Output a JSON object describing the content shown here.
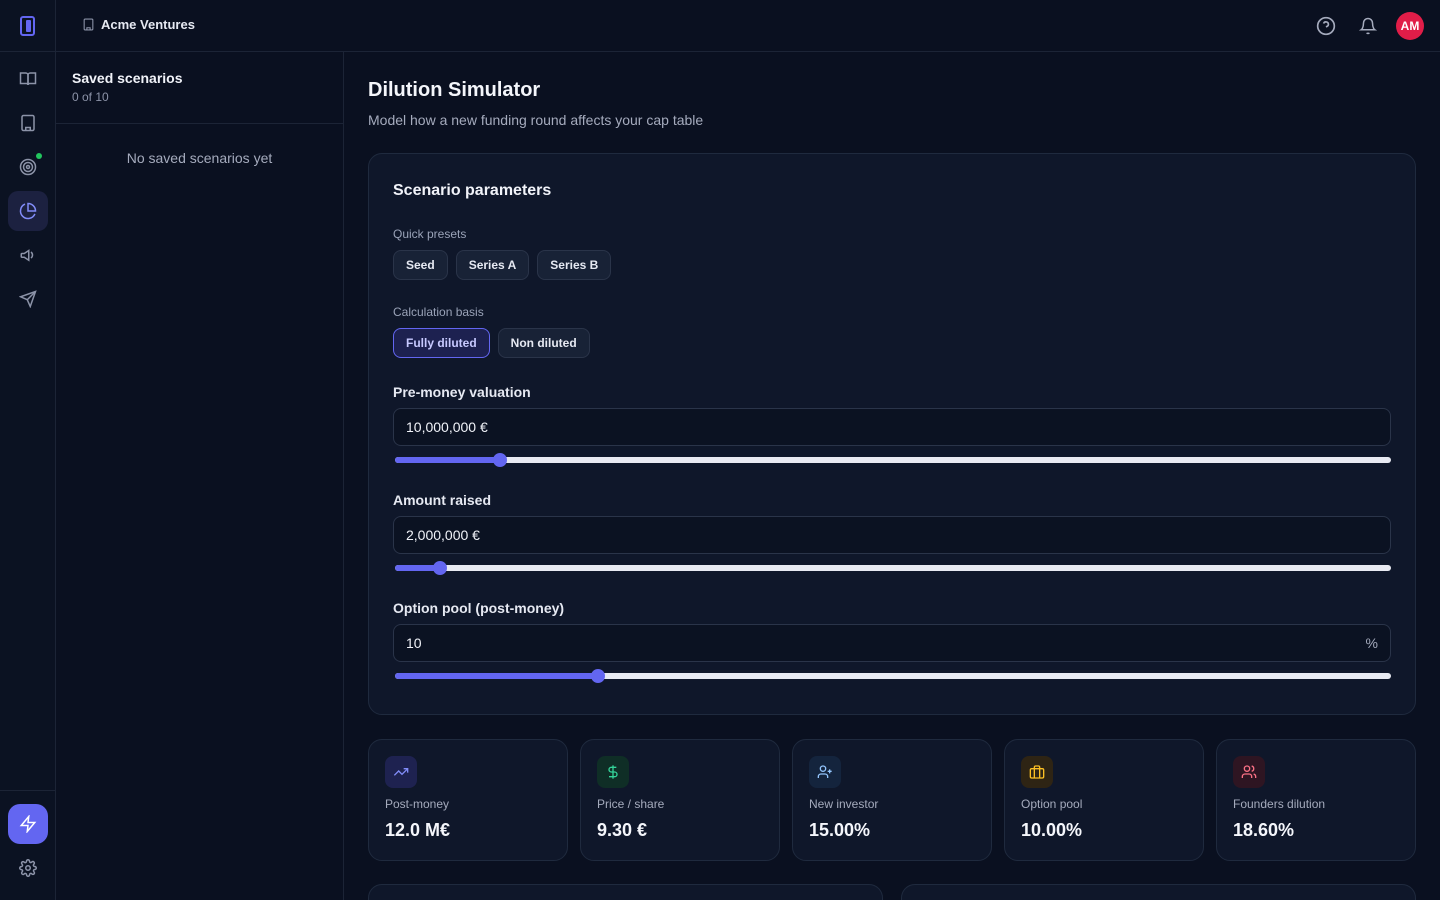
{
  "header": {
    "org_name": "Acme Ventures",
    "avatar_initials": "AM"
  },
  "colors": {
    "accent": "#6366f1",
    "avatar": "#e11d48",
    "status_dot": "#22c55e"
  },
  "rail": {
    "items": [
      "book-icon",
      "building-icon",
      "target-icon",
      "pie-chart-icon",
      "megaphone-icon",
      "send-icon"
    ],
    "active": "pie-chart-icon",
    "bottom": [
      "bolt-icon",
      "gear-icon"
    ]
  },
  "saved": {
    "title": "Saved scenarios",
    "count": "0 of 10",
    "empty": "No saved scenarios yet"
  },
  "main": {
    "title": "Dilution Simulator",
    "subtitle": "Model how a new funding round affects your cap table"
  },
  "params": {
    "title": "Scenario parameters",
    "presets_label": "Quick presets",
    "presets": [
      "Seed",
      "Series A",
      "Series B"
    ],
    "basis_label": "Calculation basis",
    "basis_options": [
      "Fully diluted",
      "Non diluted"
    ],
    "basis_selected": "Fully diluted",
    "premoney": {
      "label": "Pre-money valuation",
      "value": "10,000,000 €",
      "slider": 0.105
    },
    "raised": {
      "label": "Amount raised",
      "value": "2,000,000 €",
      "slider": 0.045
    },
    "pool": {
      "label": "Option pool (post-money)",
      "value": "10",
      "suffix": "%",
      "slider": 0.204
    }
  },
  "stats": [
    {
      "label": "Post-money",
      "value": "12.0 M€",
      "icon": "trending-up-icon",
      "color": "#818cf8",
      "bg": "#1e2250"
    },
    {
      "label": "Price / share",
      "value": "9.30 €",
      "icon": "dollar-icon",
      "color": "#34d399",
      "bg": "#0f2e26"
    },
    {
      "label": "New investor",
      "value": "15.00%",
      "icon": "user-plus-icon",
      "color": "#93c5fd",
      "bg": "#14243d"
    },
    {
      "label": "Option pool",
      "value": "10.00%",
      "icon": "briefcase-icon",
      "color": "#fbbf24",
      "bg": "#2e2414"
    },
    {
      "label": "Founders dilution",
      "value": "18.60%",
      "icon": "users-icon",
      "color": "#fb7185",
      "bg": "#2e1522"
    }
  ]
}
